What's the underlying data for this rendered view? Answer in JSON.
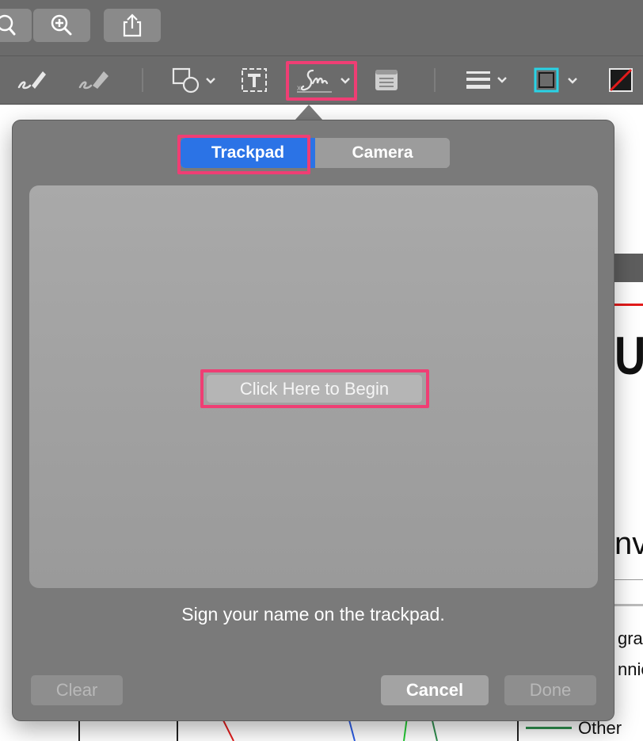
{
  "popover": {
    "tabs": [
      {
        "label": "Trackpad",
        "active": true
      },
      {
        "label": "Camera",
        "active": false
      }
    ],
    "begin_button_label": "Click Here to Begin",
    "instruction": "Sign your name on the trackpad.",
    "buttons": {
      "clear": "Clear",
      "cancel": "Cancel",
      "done": "Done"
    }
  },
  "toolbar": {
    "icons": [
      "sketch-icon",
      "draw-icon",
      "shapes-icon",
      "text-box-icon",
      "signature-icon",
      "note-icon",
      "line-style-icon",
      "border-color-icon",
      "fill-color-icon"
    ],
    "border_color": "#29d3e6",
    "fill_color": "#e31b1b",
    "highlight_color": "#ef3e74"
  },
  "document": {
    "fragments": [
      "UF",
      "nv",
      "gran",
      "nnic",
      "Other"
    ]
  },
  "colors": {
    "accent": "#2b73e6",
    "chrome": "#6b6b6b",
    "popover": "#7a7a7a"
  }
}
